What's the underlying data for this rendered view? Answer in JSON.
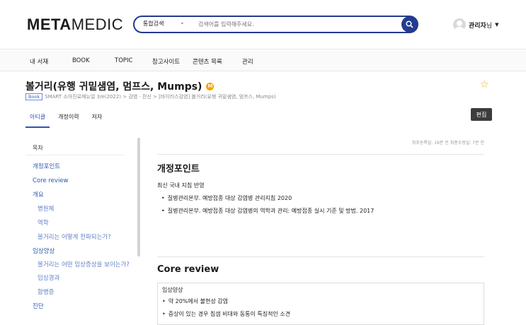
{
  "header": {
    "logo_bold": "META",
    "logo_light": "MEDIC",
    "search_scope": "통합검색",
    "search_placeholder": "검색어를 입력해주세요.",
    "user_name": "관리자",
    "user_suffix": "님",
    "user_caret": "▼"
  },
  "nav": [
    "내 서재",
    "BOOK",
    "TOPIC",
    "참고사이트",
    "콘텐츠 목록",
    "관리"
  ],
  "article": {
    "title": "볼거리(유행 귀밑샘염, 멈프스, Mumps)",
    "badge": "M",
    "book_tag": "Book",
    "breadcrumb": "SMART 소아진료매뉴얼 3/e(2022) > 감염 · 전신 > [바이러스감염] 볼거리(유행 귀밑샘염, 멈프스, Mumps)"
  },
  "tabs": [
    "아티클",
    "개정이력",
    "저자"
  ],
  "edit_label": "편집",
  "toc": {
    "heading": "목차",
    "items": [
      {
        "label": "개정포인트",
        "level": 1
      },
      {
        "label": "Core review",
        "level": 1
      },
      {
        "label": "개요",
        "level": 1
      },
      {
        "label": "병원체",
        "level": 2
      },
      {
        "label": "역학",
        "level": 2
      },
      {
        "label": "볼거리는 어떻게 전파되는가?",
        "level": 2
      },
      {
        "label": "임상양상",
        "level": 1
      },
      {
        "label": "볼거리는 어떤 임상증상을 보이는가?",
        "level": 3
      },
      {
        "label": "임상경과",
        "level": 2
      },
      {
        "label": "합병증",
        "level": 2
      },
      {
        "label": "진단",
        "level": 1
      }
    ]
  },
  "content": {
    "dates": "최초등록일: 19분 전    최종수정일: 7분 전",
    "revision_title": "개정포인트",
    "revision_sub": "최신 국내 지침 반영",
    "revision_bullets": [
      "질병관리본부. 예방접종 대상 감염병 관리지침 2020",
      "질병관리본부. 예방접종 대상 감염병의 역학과 관리: 예방접종 실시 기준 및 방법. 2017"
    ],
    "core_title": "Core review",
    "core_sub": "임상양상",
    "core_bullets": [
      "약 20%에서 불현성 감염",
      "증상이 있는 경우 침샘 비대와 동통이 특징적인 소견"
    ]
  },
  "colors": {
    "brand": "#243b8f",
    "link": "#2b55b0",
    "star": "#f0b400",
    "badge": "#f5a300"
  }
}
